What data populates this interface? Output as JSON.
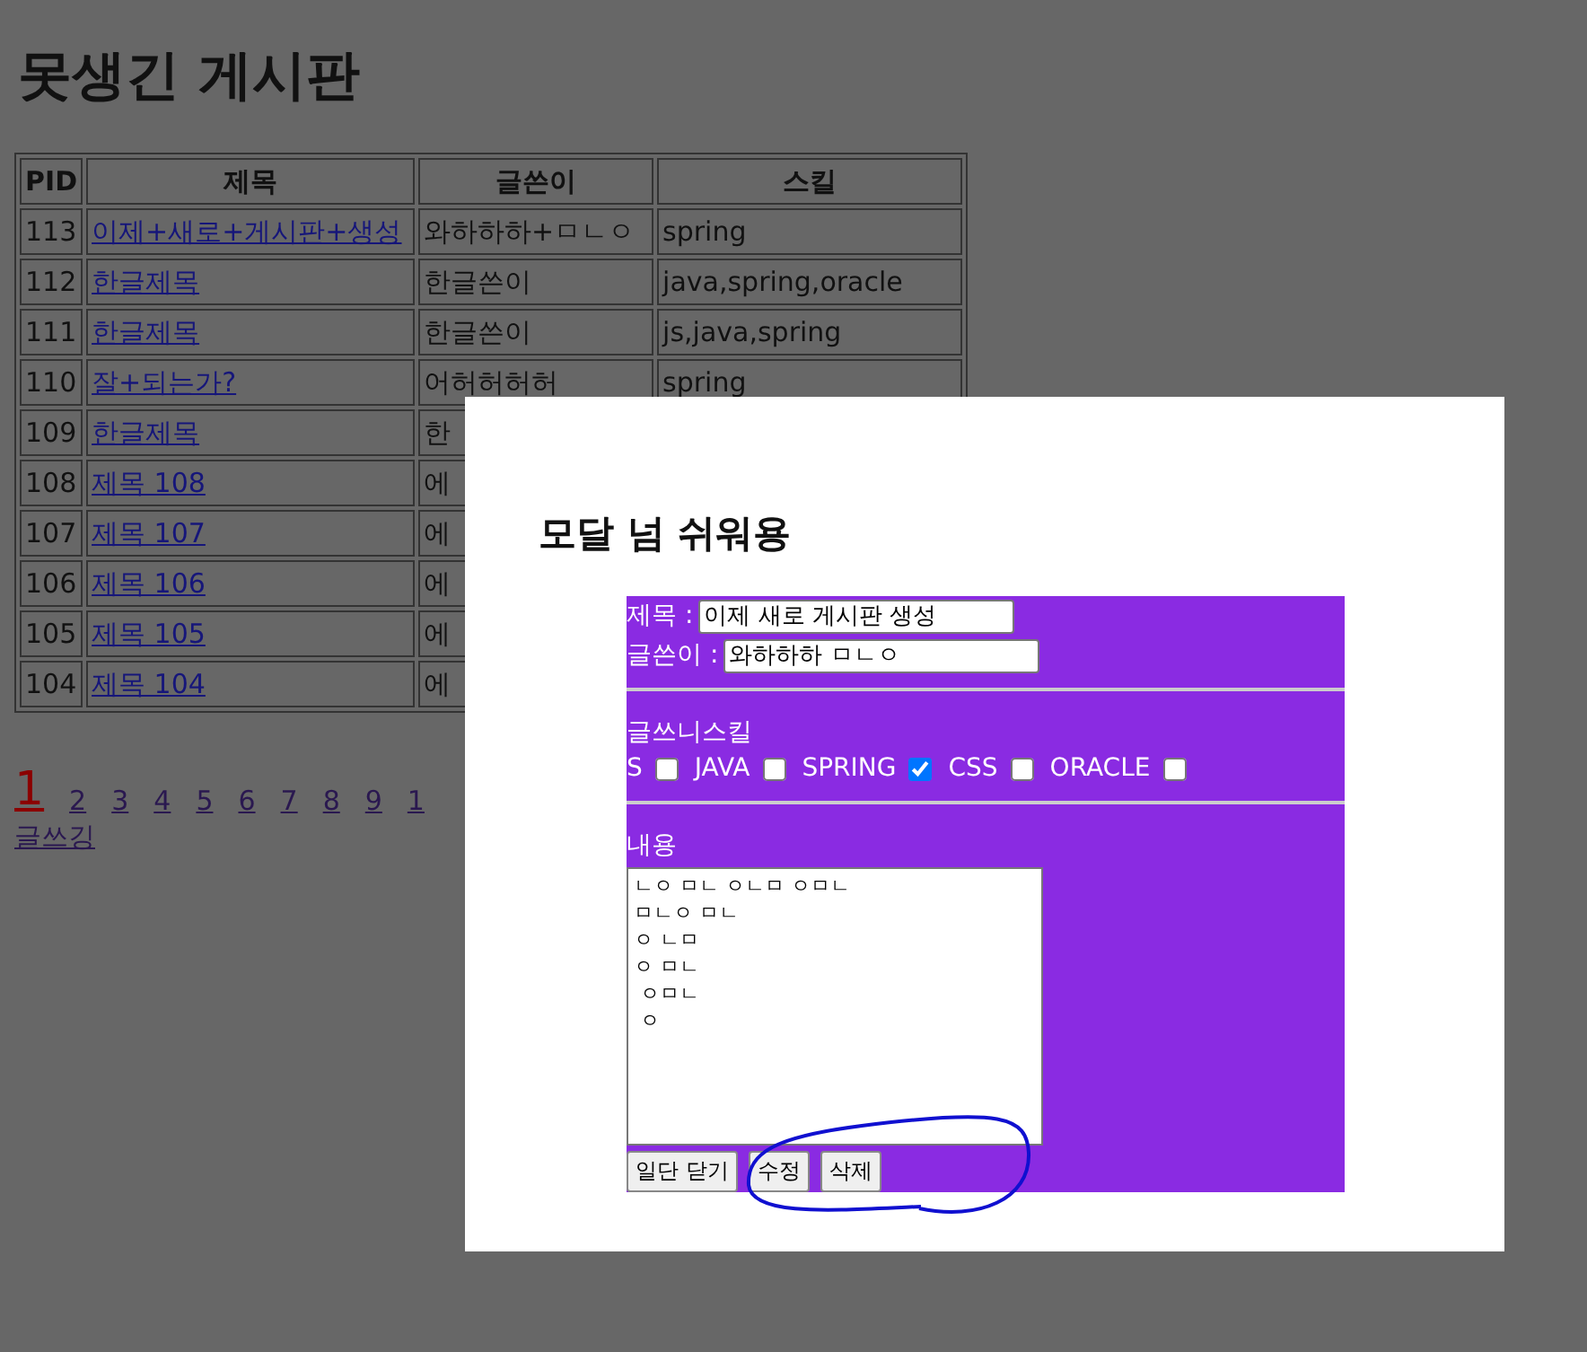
{
  "page_title": "못생긴 게시판",
  "table": {
    "columns": [
      "PID",
      "제목",
      "글쓴이",
      "스킬"
    ],
    "rows": [
      {
        "pid": "113",
        "title": "이제+새로+게시판+생성",
        "author": "와하하하+ㅁㄴㅇ",
        "skills": "spring"
      },
      {
        "pid": "112",
        "title": "한글제목",
        "author": "한글쓴이",
        "skills": "java,spring,oracle"
      },
      {
        "pid": "111",
        "title": "한글제목",
        "author": "한글쓴이",
        "skills": "js,java,spring"
      },
      {
        "pid": "110",
        "title": "잘+되는가?",
        "author": "어허허허허",
        "skills": "spring"
      },
      {
        "pid": "109",
        "title": "한글제목",
        "author": "한"
      },
      {
        "pid": "108",
        "title": "제목 108",
        "author": "에"
      },
      {
        "pid": "107",
        "title": "제목 107",
        "author": "에"
      },
      {
        "pid": "106",
        "title": "제목 106",
        "author": "에"
      },
      {
        "pid": "105",
        "title": "제목 105",
        "author": "에"
      },
      {
        "pid": "104",
        "title": "제목 104",
        "author": "에"
      }
    ]
  },
  "pagination": [
    {
      "label": "1",
      "selected": true
    },
    {
      "label": "2",
      "selected": false
    },
    {
      "label": "3",
      "selected": false
    },
    {
      "label": "4",
      "selected": false
    },
    {
      "label": "5",
      "selected": false
    },
    {
      "label": "6",
      "selected": false
    },
    {
      "label": "7",
      "selected": false
    },
    {
      "label": "8",
      "selected": false
    },
    {
      "label": "9",
      "selected": false
    },
    {
      "label": "1",
      "selected": false
    }
  ],
  "write_link": "글쓰깅",
  "modal": {
    "title": "모달 넘 쉬워용",
    "fields": [
      {
        "label": "제목 :",
        "value": "이제 새로 게시판 생성"
      },
      {
        "label": "글쓴이 :",
        "value": "와하하하 ㅁㄴㅇ"
      }
    ],
    "skills_label": "글쓰니스킬",
    "skills": [
      {
        "label": "S",
        "checked": false
      },
      {
        "label": "JAVA",
        "checked": false
      },
      {
        "label": "SPRING",
        "checked": true
      },
      {
        "label": "CSS",
        "checked": false
      },
      {
        "label": "ORACLE",
        "checked": false
      }
    ],
    "content_label": "내용",
    "content_lines": [
      "ㄴㅇ ㅁㄴ ㅇㄴㅁ ㅇㅁㄴ",
      "ㅁㄴㅇ ㅁㄴ",
      "ㅇ ㄴㅁ",
      "ㅇ ㅁㄴ",
      " ㅇㅁㄴ",
      " ㅇ"
    ],
    "buttons": [
      "일단 닫기",
      "수정",
      "삭제"
    ]
  }
}
